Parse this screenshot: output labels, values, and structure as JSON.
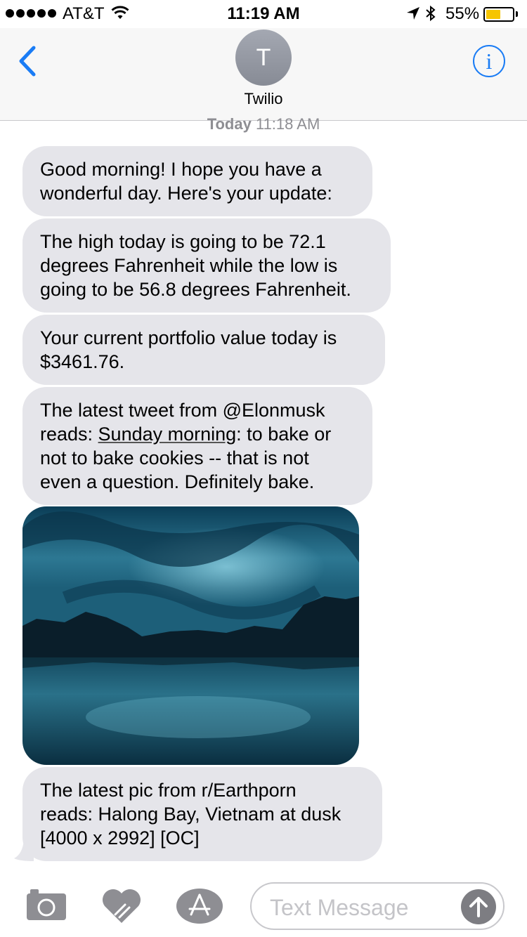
{
  "status_bar": {
    "carrier": "AT&T",
    "time": "11:19 AM",
    "battery_percent": "55%",
    "battery_level": 0.55,
    "icons": [
      "signal-dots-icon",
      "wifi-icon",
      "location-arrow-icon",
      "bluetooth-icon",
      "battery-icon"
    ]
  },
  "header": {
    "avatar_initial": "T",
    "contact_name": "Twilio",
    "info_glyph": "i",
    "accent_color": "#1a7cf5"
  },
  "thread": {
    "timestamp_day": "Today",
    "timestamp_time": "11:18 AM",
    "messages": [
      {
        "lines": [
          "Good morning! I hope you have a",
          "wonderful day. Here's your update:"
        ]
      },
      {
        "lines": [
          "The high today is going to be 72.1",
          "degrees Fahrenheit while the low is",
          "going to be 56.8 degrees Fahrenheit."
        ]
      },
      {
        "lines": [
          "Your current portfolio value today is",
          "$3461.76."
        ]
      },
      {
        "line1": "The latest tweet from @Elonmusk",
        "line2_prefix": "reads: ",
        "line2_link": "Sunday morning",
        "line2_suffix": ": to bake or",
        "line3": "not to bake cookies -- that is not",
        "line4": "even a question. Definitely bake."
      },
      {
        "lines": [
          "The latest pic from r/Earthporn",
          "reads: Halong Bay, Vietnam at dusk",
          "[4000 x 2992] [OC]"
        ]
      }
    ],
    "bubble_color": "#e5e5ea"
  },
  "composer": {
    "placeholder": "Text Message",
    "icons": [
      "camera-icon",
      "digital-touch-heart-icon",
      "app-store-icon",
      "send-arrow-icon"
    ]
  }
}
